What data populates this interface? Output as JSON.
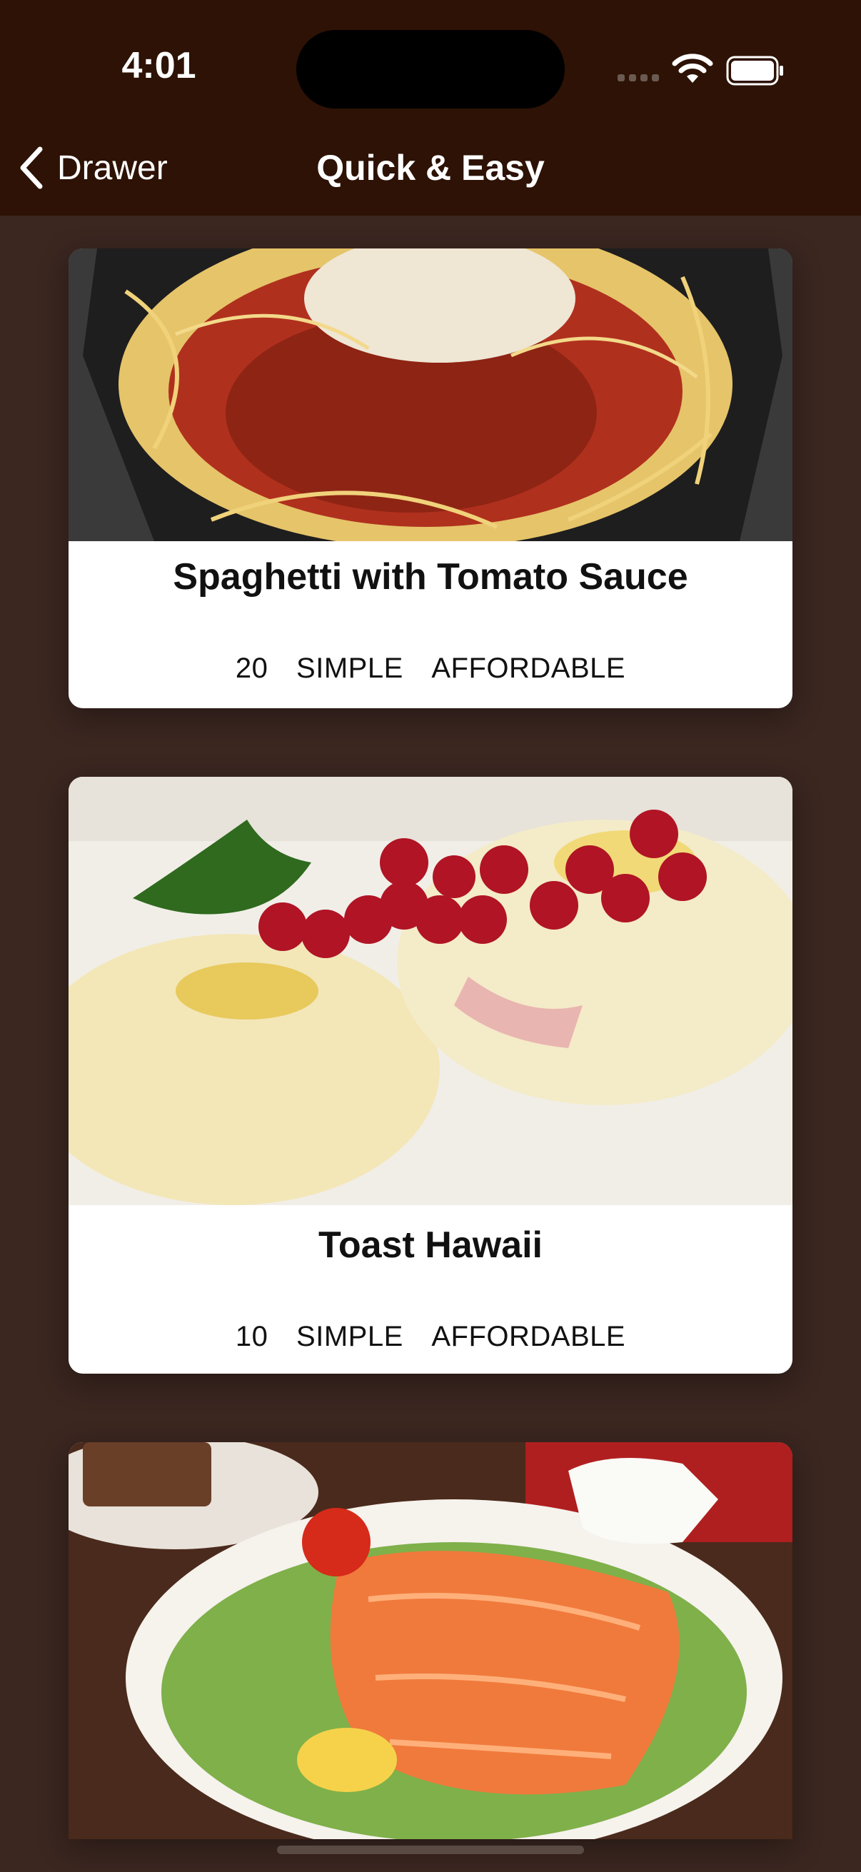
{
  "status_bar": {
    "time": "4:01"
  },
  "nav": {
    "back_label": "Drawer",
    "title": "Quick & Easy"
  },
  "meals": [
    {
      "title": "Spaghetti with Tomato Sauce",
      "duration": "20",
      "complexity": "SIMPLE",
      "affordability": "AFFORDABLE",
      "image": "spaghetti-photo"
    },
    {
      "title": "Toast Hawaii",
      "duration": "10",
      "complexity": "SIMPLE",
      "affordability": "AFFORDABLE",
      "image": "toast-hawaii-photo"
    },
    {
      "title": "",
      "duration": "",
      "complexity": "",
      "affordability": "",
      "image": "salmon-salad-photo"
    }
  ],
  "colors": {
    "header": "#2d1205",
    "background": "#3b2620",
    "card": "#ffffff"
  }
}
